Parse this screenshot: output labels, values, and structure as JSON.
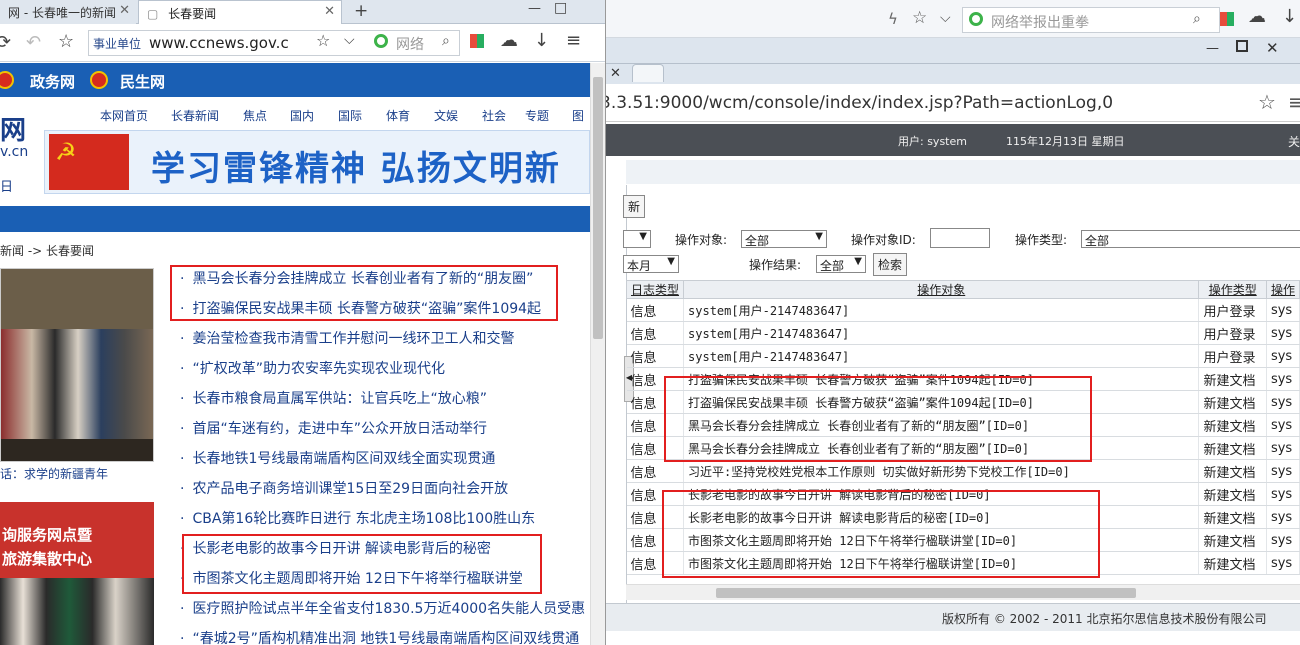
{
  "left_browser": {
    "tabs": [
      {
        "label": "网 - 长春唯一的新闻"
      },
      {
        "label": "长春要闻"
      }
    ],
    "new_tab": "+",
    "window_controls": [
      "—",
      "□"
    ],
    "url_tag": "事业单位",
    "url": "www.ccnews.gov.c",
    "search_placeholder": "网络"
  },
  "site": {
    "top_labels": [
      "政务网",
      "民生网"
    ],
    "menu": [
      "本网首页",
      "长春新闻",
      "焦点",
      "国内",
      "国际",
      "体育",
      "文娱",
      "社会",
      "专题",
      "图"
    ],
    "logo": {
      "line1": "网",
      "line2": "v.cn",
      "line3": "日"
    },
    "banner_text": "学习雷锋精神  弘扬文明新",
    "breadcrumb": "新闻 -> 长春要闻",
    "photo1_caption": "话：求学的新疆青年",
    "photo2_lines": [
      "询服务网点暨",
      "旅游集散中心"
    ],
    "news": [
      "黑马会长春分会挂牌成立 长春创业者有了新的“朋友圈”",
      "打盗骗保民安战果丰硕 长春警方破获“盗骗”案件1094起",
      "姜治莹检查我市清雪工作并慰问一线环卫工人和交警",
      "“扩权改革”助力农安率先实现农业现代化",
      "长春市粮食局直属军供站：让官兵吃上“放心粮”",
      "首届“车迷有约，走进中车”公众开放日活动举行",
      "长春地铁1号线最南端盾构区间双线全面实现贯通",
      "农产品电子商务培训课堂15日至29日面向社会开放",
      "CBA第16轮比赛昨日进行 东北虎主场108比100胜山东",
      "长影老电影的故事今日开讲 解读电影背后的秘密",
      "市图茶文化主题周即将开始 12日下午将举行楹联讲堂",
      "医疗照护险试点半年全省支付1830.5万近4000名失能人员受惠",
      "“春城2号”盾构机精准出洞 地铁1号线最南端盾构区间双线贯通"
    ]
  },
  "right_browser": {
    "search_placeholder": "网络举报出重拳",
    "url": "3.3.51:9000/wcm/console/index/index.jsp?Path=actionLog,0",
    "appbar": {
      "user": "用户: system",
      "date": "115年12月13日 星期日",
      "right": "关"
    },
    "new_button": "新",
    "filters": {
      "operation_object_label": "操作对象:",
      "operation_object_value": "全部",
      "object_id_label": "操作对象ID:",
      "operation_type_label": "操作类型:",
      "operation_type_value": "全部",
      "period_value": "本月",
      "result_label": "操作结果:",
      "result_value": "全部",
      "search_button": "检索"
    },
    "table": {
      "headers": [
        "日志类型",
        "操作对象",
        "操作类型",
        "操作"
      ],
      "rows": [
        [
          "信息",
          "system[用户-2147483647]",
          "用户登录",
          "sys"
        ],
        [
          "信息",
          "system[用户-2147483647]",
          "用户登录",
          "sys"
        ],
        [
          "信息",
          "system[用户-2147483647]",
          "用户登录",
          "sys"
        ],
        [
          "信息",
          "打盗骗保民安战果丰硕  长春警方破获“盗骗”案件1094起[ID=0]",
          "新建文档",
          "sys"
        ],
        [
          "信息",
          "打盗骗保民安战果丰硕  长春警方破获“盗骗”案件1094起[ID=0]",
          "新建文档",
          "sys"
        ],
        [
          "信息",
          "黑马会长春分会挂牌成立  长春创业者有了新的“朋友圈”[ID=0]",
          "新建文档",
          "sys"
        ],
        [
          "信息",
          "黑马会长春分会挂牌成立  长春创业者有了新的“朋友圈”[ID=0]",
          "新建文档",
          "sys"
        ],
        [
          "信息",
          "习近平:坚持党校姓党根本工作原则  切实做好新形势下党校工作[ID=0]",
          "新建文档",
          "sys"
        ],
        [
          "信息",
          "长影老电影的故事今日开讲  解读电影背后的秘密[ID=0]",
          "新建文档",
          "sys"
        ],
        [
          "信息",
          "长影老电影的故事今日开讲  解读电影背后的秘密[ID=0]",
          "新建文档",
          "sys"
        ],
        [
          "信息",
          "市图茶文化主题周即将开始  12日下午将举行楹联讲堂[ID=0]",
          "新建文档",
          "sys"
        ],
        [
          "信息",
          "市图茶文化主题周即将开始  12日下午将举行楹联讲堂[ID=0]",
          "新建文档",
          "sys"
        ]
      ]
    },
    "footer": "版权所有 © 2002 - 2011 北京拓尔思信息技术股份有限公司"
  },
  "colors": {
    "highlight_box": "#e21f1f",
    "site_blue": "#1a5fb4",
    "link": "#1a3f8a"
  }
}
